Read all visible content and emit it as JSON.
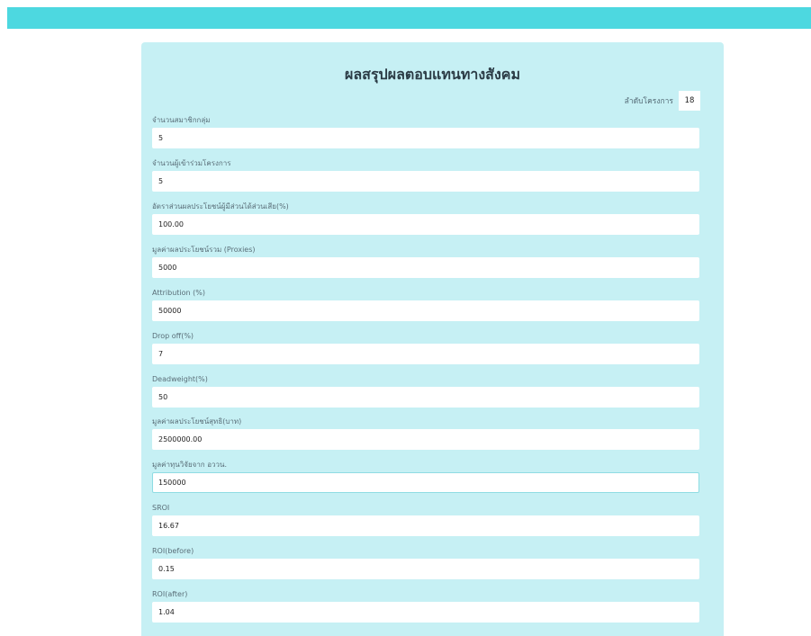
{
  "page": {
    "title": "ผลสรุปผลตอบแทนทางสังคม",
    "project_order_label": "ลำดับโครงการ",
    "project_order_value": "18"
  },
  "fields": [
    {
      "label": "จำนวนสมาชิกกลุ่ม",
      "value": "5"
    },
    {
      "label": "จำนวนผู้เข้าร่วมโครงการ",
      "value": "5"
    },
    {
      "label": "อัตราส่วนผลประโยชน์ผู้มีส่วนได้ส่วนเสีย(%)",
      "value": "100.00"
    },
    {
      "label": "มูลค่าผลประโยชน์รวม (Proxies)",
      "value": "5000"
    },
    {
      "label": "Attribution (%)",
      "value": "50000"
    },
    {
      "label": "Drop off(%)",
      "value": "7"
    },
    {
      "label": "Deadweight(%)",
      "value": "50"
    },
    {
      "label": "มูลค่าผลประโยชน์สุทธิ(บาท)",
      "value": "2500000.00"
    },
    {
      "label": "มูลค่าทุนวิจัยจาก อววน.",
      "value": "150000"
    },
    {
      "label": "SROI",
      "value": "16.67"
    },
    {
      "label": "ROI(before)",
      "value": "0.15"
    },
    {
      "label": "ROI(after)",
      "value": "1.04"
    }
  ]
}
